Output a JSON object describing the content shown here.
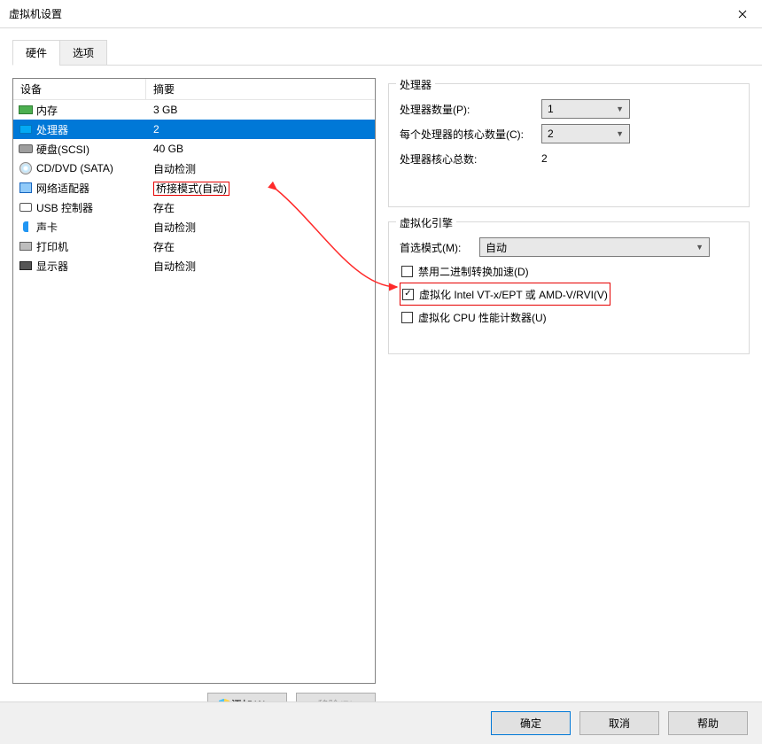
{
  "window": {
    "title": "虚拟机设置"
  },
  "tabs": {
    "hardware": "硬件",
    "options": "选项",
    "active": "hardware"
  },
  "list": {
    "headers": {
      "device": "设备",
      "summary": "摘要"
    },
    "rows": [
      {
        "id": "memory",
        "label": "内存",
        "summary": "3 GB",
        "icon": "ico-mem"
      },
      {
        "id": "cpu",
        "label": "处理器",
        "summary": "2",
        "icon": "ico-cpu",
        "selected": true
      },
      {
        "id": "disk",
        "label": "硬盘(SCSI)",
        "summary": "40 GB",
        "icon": "ico-disk"
      },
      {
        "id": "cd",
        "label": "CD/DVD (SATA)",
        "summary": "自动检测",
        "icon": "ico-cd"
      },
      {
        "id": "net",
        "label": "网络适配器",
        "summary": "桥接模式(自动)",
        "icon": "ico-net",
        "summaryRedBox": true
      },
      {
        "id": "usb",
        "label": "USB 控制器",
        "summary": "存在",
        "icon": "ico-usb"
      },
      {
        "id": "sound",
        "label": "声卡",
        "summary": "自动检测",
        "icon": "ico-sound"
      },
      {
        "id": "printer",
        "label": "打印机",
        "summary": "存在",
        "icon": "ico-printer"
      },
      {
        "id": "display",
        "label": "显示器",
        "summary": "自动检测",
        "icon": "ico-display"
      }
    ]
  },
  "left_buttons": {
    "add": "添加(A)...",
    "remove": "移除(R)"
  },
  "cpu_group": {
    "legend": "处理器",
    "count_label": "处理器数量(P):",
    "count_value": "1",
    "cores_label": "每个处理器的核心数量(C):",
    "cores_value": "2",
    "total_label": "处理器核心总数:",
    "total_value": "2"
  },
  "virt_group": {
    "legend": "虚拟化引擎",
    "mode_label": "首选模式(M):",
    "mode_value": "自动",
    "cb_disable_binary": "禁用二进制转换加速(D)",
    "cb_vt": "虚拟化 Intel VT-x/EPT 或 AMD-V/RVI(V)",
    "cb_perf": "虚拟化 CPU 性能计数器(U)",
    "vt_checked": true
  },
  "footer": {
    "ok": "确定",
    "cancel": "取消",
    "help": "帮助"
  }
}
